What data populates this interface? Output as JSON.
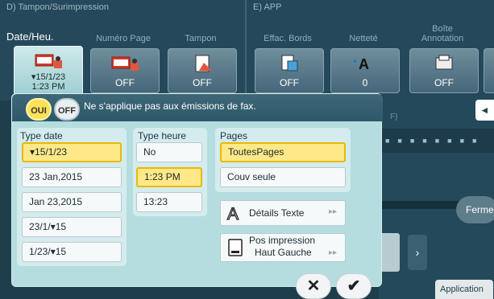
{
  "sections": {
    "left": "D) Tampon/Surimpression",
    "right": "E) APP"
  },
  "columns": [
    {
      "label": "Date/Heu.",
      "value": "▾15/1/23\n1:23 PM",
      "icon": "date-icon"
    },
    {
      "label": "Numéro Page",
      "value": "OFF",
      "icon": "page-number-icon"
    },
    {
      "label": "Tampon",
      "value": "OFF",
      "icon": "stamp-icon"
    },
    {
      "label": "Effac. Bords",
      "value": "OFF",
      "icon": "frame-erase-icon"
    },
    {
      "label": "Netteté",
      "value": "0",
      "icon": "sharpness-icon"
    },
    {
      "label": "Boîte\nAnnotation",
      "value": "OFF",
      "icon": "annotation-box-icon"
    }
  ],
  "panel": {
    "oui": "OUI",
    "off": "OFF",
    "message": "Ne s'applique pas aux émissions de fax.",
    "type_date": {
      "title": "Type date",
      "options": [
        "▾15/1/23",
        "23 Jan,2015",
        "Jan 23,2015",
        "23/1/▾15",
        "1/23/▾15"
      ],
      "selected": 0
    },
    "type_heure": {
      "title": "Type heure",
      "options": [
        "No",
        "1:23 PM",
        "13:23"
      ],
      "selected": 1
    },
    "pages": {
      "title": "Pages",
      "options": [
        "ToutesPages",
        "Couv seule"
      ],
      "selected": 0
    },
    "details_texte": "Détails Texte",
    "pos_impression": "Pos impression",
    "pos_value": "Haut Gauche"
  },
  "right_partial": {
    "f_label": "F)",
    "fermer": "Fermer",
    "application": "Application"
  },
  "colors": {
    "accent_yellow": "#ffe887",
    "panel_bg": "#b5dde0",
    "header_bg": "#25485a"
  }
}
